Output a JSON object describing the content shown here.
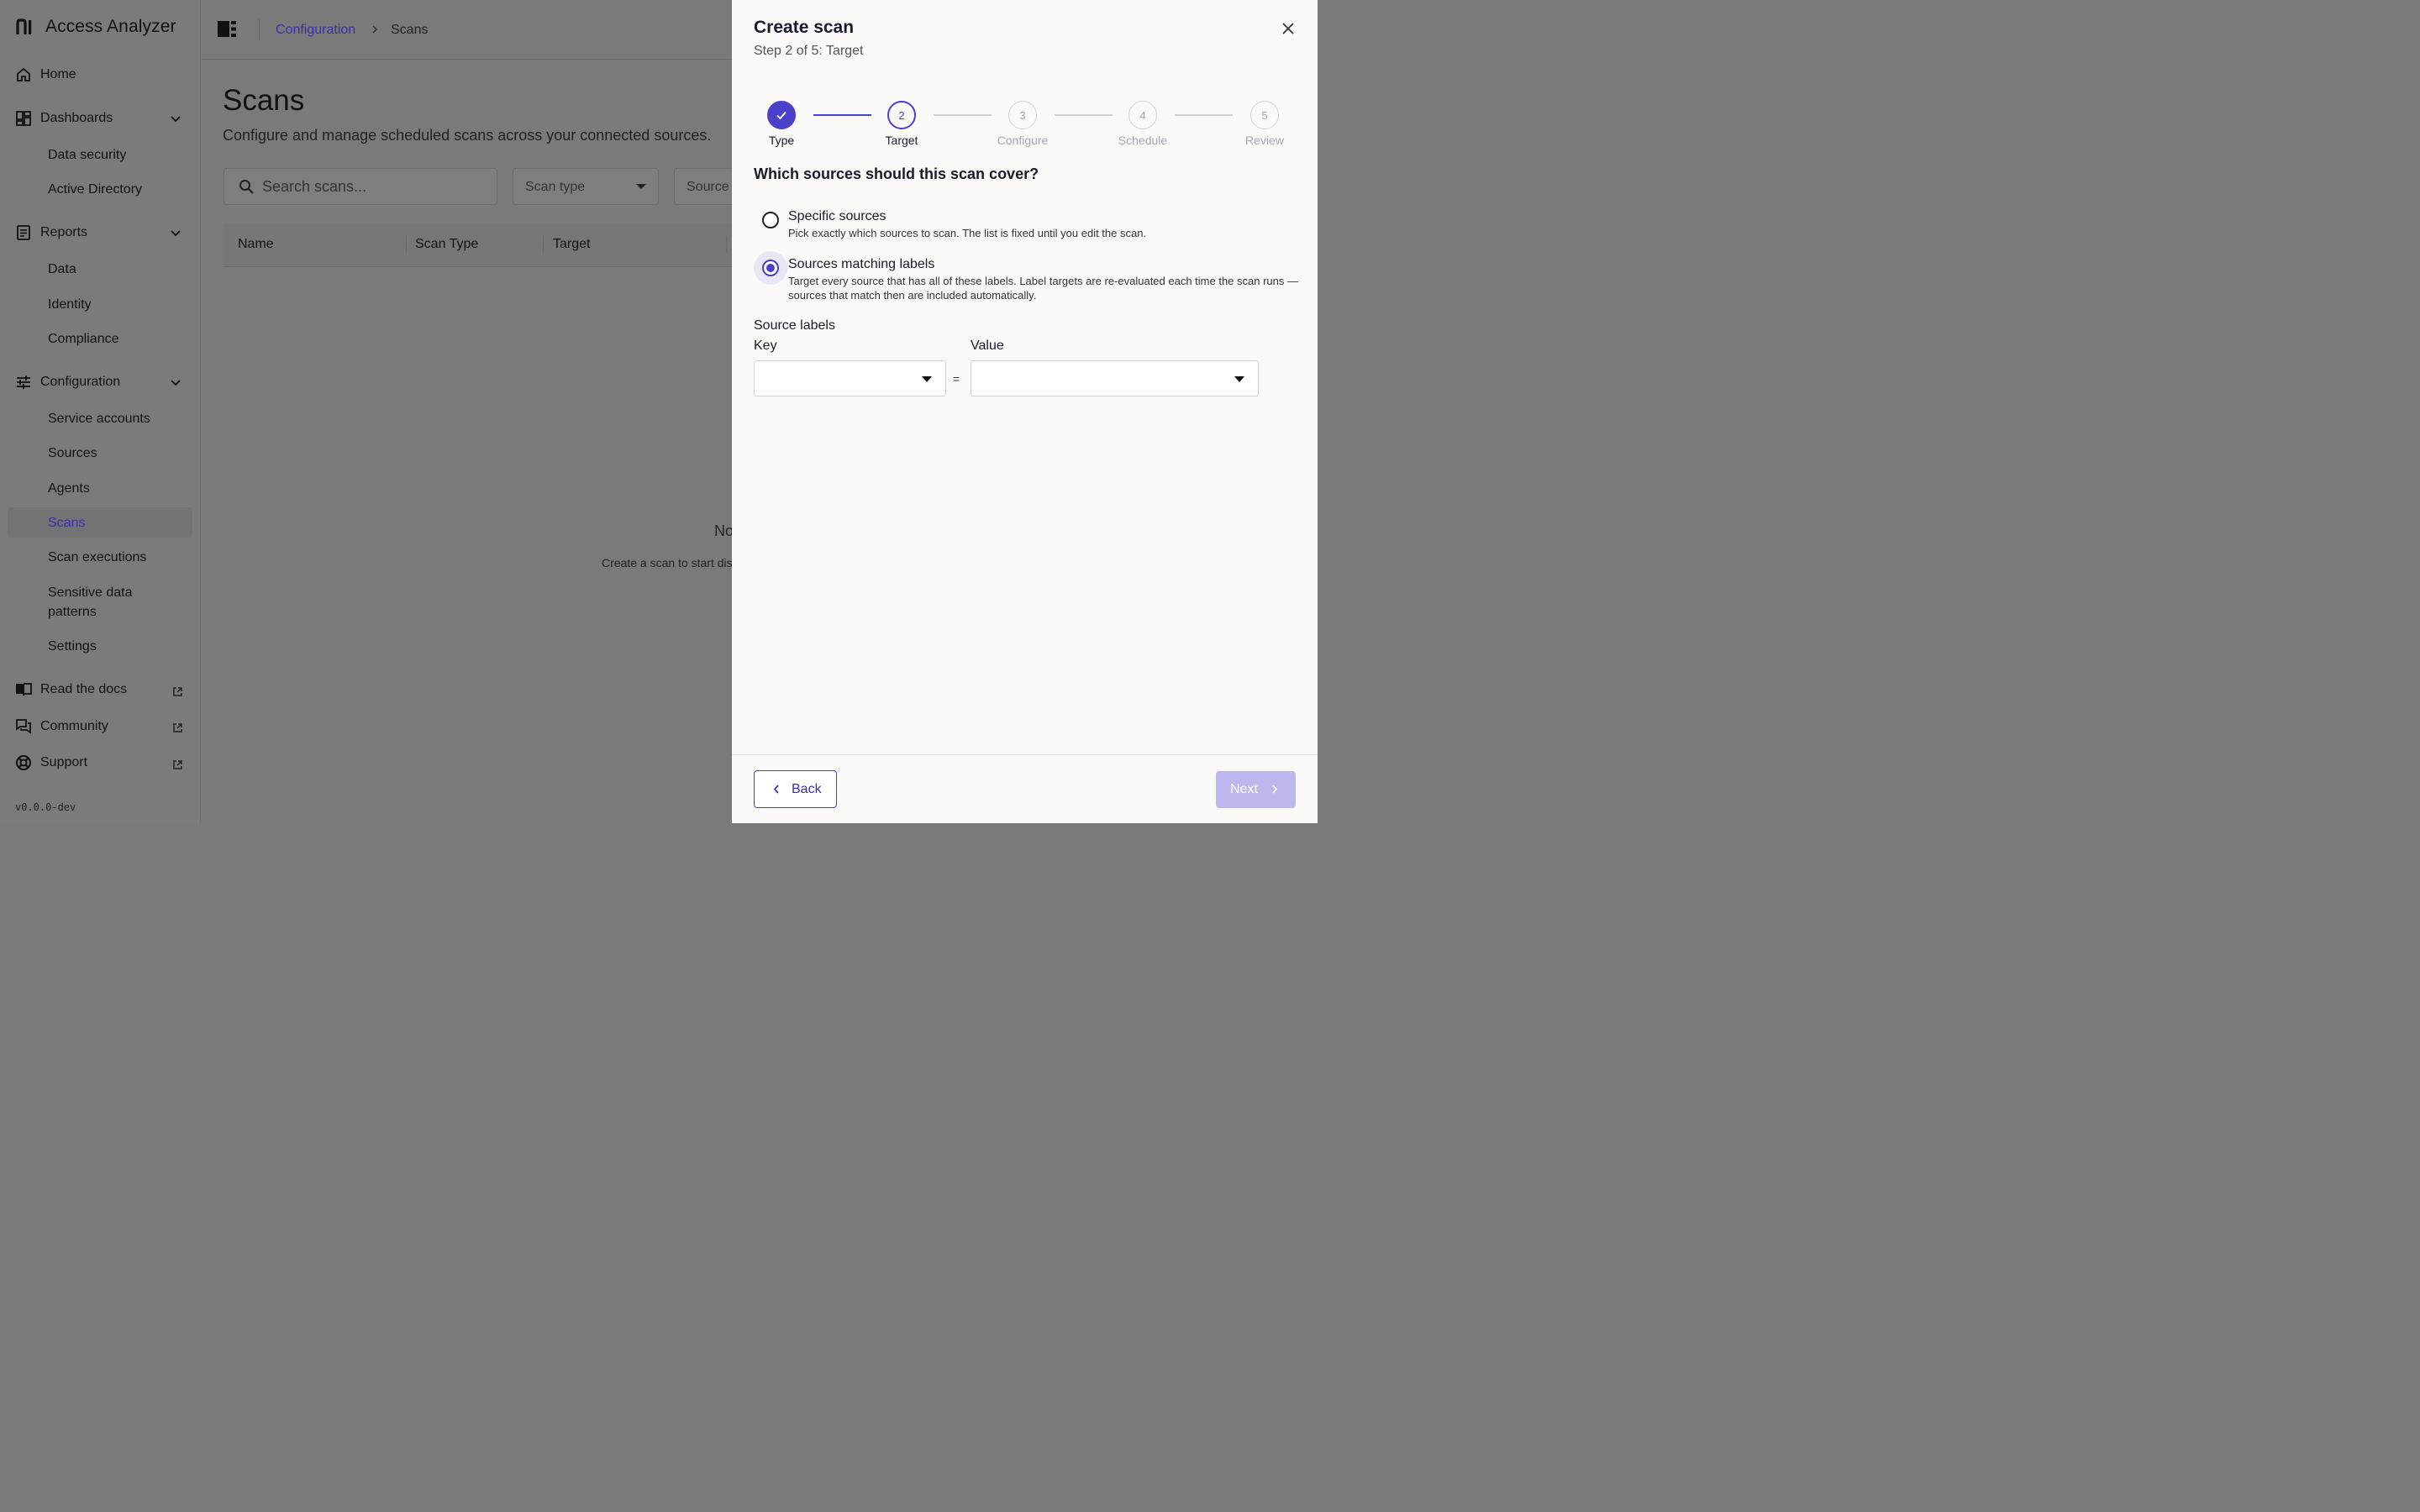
{
  "app": {
    "name": "Access Analyzer",
    "version": "v0.0.0-dev"
  },
  "sidebar": {
    "home": "Home",
    "dashboards": {
      "label": "Dashboards",
      "items": [
        "Data security",
        "Active Directory"
      ]
    },
    "reports": {
      "label": "Reports",
      "items": [
        "Data",
        "Identity",
        "Compliance"
      ]
    },
    "configuration": {
      "label": "Configuration",
      "items": [
        "Service accounts",
        "Sources",
        "Agents",
        "Scans",
        "Scan executions",
        "Sensitive data patterns",
        "Settings"
      ],
      "active": "Scans"
    },
    "links": [
      "Read the docs",
      "Community",
      "Support"
    ]
  },
  "breadcrumb": {
    "parent": "Configuration",
    "current": "Scans"
  },
  "page": {
    "title": "Scans",
    "subtitle": "Configure and manage scheduled scans across your connected sources.",
    "search_placeholder": "Search scans...",
    "filters": [
      "Scan type",
      "Source"
    ],
    "columns": [
      "Name",
      "Scan Type",
      "Target"
    ],
    "empty_title": "No",
    "empty_sub": "Create a scan to start dis"
  },
  "drawer": {
    "title": "Create scan",
    "step_text": "Step 2 of 5: Target",
    "steps": [
      {
        "num": "1",
        "label": "Type",
        "state": "done"
      },
      {
        "num": "2",
        "label": "Target",
        "state": "current"
      },
      {
        "num": "3",
        "label": "Configure",
        "state": "upcoming"
      },
      {
        "num": "4",
        "label": "Schedule",
        "state": "upcoming"
      },
      {
        "num": "5",
        "label": "Review",
        "state": "upcoming"
      }
    ],
    "question": "Which sources should this scan cover?",
    "options": [
      {
        "title": "Specific sources",
        "desc": "Pick exactly which sources to scan. The list is fixed until you edit the scan.",
        "selected": false
      },
      {
        "title": "Sources matching labels",
        "desc": "Target every source that has all of these labels. Label targets are re-evaluated each time the scan runs — sources that match then are included automatically.",
        "selected": true
      }
    ],
    "labels_section": "Source labels",
    "key_label": "Key",
    "value_label": "Value",
    "equals": "=",
    "back": "Back",
    "next": "Next"
  },
  "colors": {
    "accent": "#4b40c9",
    "link": "#3a2fb3",
    "next_disabled": "#bcb7ec",
    "overlay": "#7a7a7a"
  }
}
